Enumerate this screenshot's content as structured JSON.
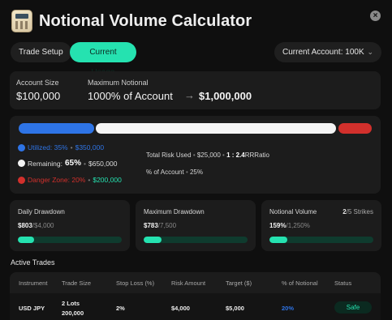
{
  "app": {
    "title": "Notional Volume Calculator",
    "close_icon": "×"
  },
  "tabs": [
    {
      "label": "Trade Setup"
    },
    {
      "label": "Current Usage"
    }
  ],
  "account_select": {
    "label": "Current Account: 100K",
    "chevron": "⌄"
  },
  "summary": {
    "account_size_label": "Account Size",
    "account_size_value": "$100,000",
    "max_notional_label": "Maximum Notional",
    "max_notional_percent": "1000% of Account",
    "arrow": "→",
    "max_notional_value": "$1,000,000"
  },
  "usage": {
    "utilized": {
      "label": "Utilized: 35%",
      "sep": "•",
      "value": "$350,000",
      "color": "#2e74e6"
    },
    "remaining": {
      "label": "Remaining:",
      "percent": "65%",
      "sep": "•",
      "value": "$650,000",
      "color": "#f4f4f4"
    },
    "danger": {
      "label": "Danger Zone: 20%",
      "sep": "•",
      "value": "$200,000",
      "color": "#d2302c"
    },
    "total_risk_label": "Total Risk Used",
    "total_risk_sep": "•",
    "total_risk_value": "$25,000",
    "rr_sep": "•",
    "rr_value": "1 : 2.4",
    "rr_label": "RRRatio",
    "pct_account_label": "% of Account",
    "pct_account_sep": "•",
    "pct_account_value": "25%"
  },
  "metrics": [
    {
      "title": "Daily Drawdown",
      "value": "$803",
      "limit": "/$4,000",
      "fill_fraction": 0.16
    },
    {
      "title": "Maximum Drawdown",
      "value": "$783",
      "limit": "/7,500",
      "fill_fraction": 0.17
    },
    {
      "title": "Notional Volume",
      "value": "159%",
      "limit": "/1,250%",
      "fill_fraction": 0.17,
      "strikes_count": "2",
      "strikes_label": "/5 Strikes"
    }
  ],
  "active_trades": {
    "title": "Active Trades",
    "columns": [
      "Instrument",
      "Trade Size",
      "Stop Loss (%)",
      "Risk Amount",
      "Target ($)",
      "% of Notional",
      "Status"
    ],
    "rows": [
      {
        "instrument": "USD JPY",
        "trade_size_line1": "2 Lots",
        "trade_size_line2": "200,000",
        "stop_loss": "2%",
        "risk_amount": "$4,000",
        "target": "$5,000",
        "notional_pct": "20%",
        "status": "Safe"
      }
    ]
  },
  "colors": {
    "accent": "#25e2b0",
    "blue": "#2e74e6",
    "red": "#d2302c",
    "background": "#0f0f0f",
    "card": "#1c1c1c"
  }
}
